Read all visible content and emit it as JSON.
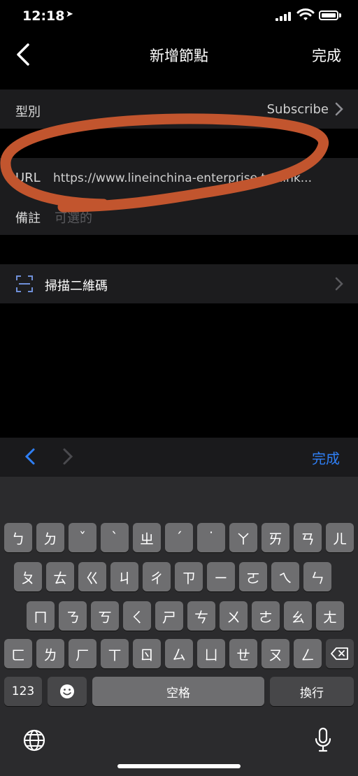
{
  "status_bar": {
    "time": "12:18",
    "location_icon": "location-arrow-icon"
  },
  "nav": {
    "title": "新增節點",
    "done": "完成"
  },
  "type_row": {
    "label": "型別",
    "value": "Subscribe"
  },
  "url_row": {
    "label": "URL",
    "value": "https://www.lineinchina-enterprise.tw/link..."
  },
  "note_row": {
    "label": "備註",
    "placeholder": "可選的"
  },
  "scan_row": {
    "label": "掃描二維碼"
  },
  "keyboard_toolbar": {
    "done": "完成"
  },
  "keyboard": {
    "row1": [
      "ㄅ",
      "ㄉ",
      "ˇ",
      "ˋ",
      "ㄓ",
      "ˊ",
      "˙",
      "ㄚ",
      "ㄞ",
      "ㄢ",
      "ㄦ"
    ],
    "row2": [
      "ㄆ",
      "ㄊ",
      "ㄍ",
      "ㄐ",
      "ㄔ",
      "ㄗ",
      "ㄧ",
      "ㄛ",
      "ㄟ",
      "ㄣ"
    ],
    "row3": [
      "ㄇ",
      "ㄋ",
      "ㄎ",
      "ㄑ",
      "ㄕ",
      "ㄘ",
      "ㄨ",
      "ㄜ",
      "ㄠ",
      "ㄤ"
    ],
    "row4": [
      "ㄈ",
      "ㄌ",
      "ㄏ",
      "ㄒ",
      "ㄖ",
      "ㄙ",
      "ㄩ",
      "ㄝ",
      "ㄡ",
      "ㄥ"
    ],
    "numbers": "123",
    "space": "空格",
    "return": "換行"
  },
  "annotation_color": "#c2552e"
}
